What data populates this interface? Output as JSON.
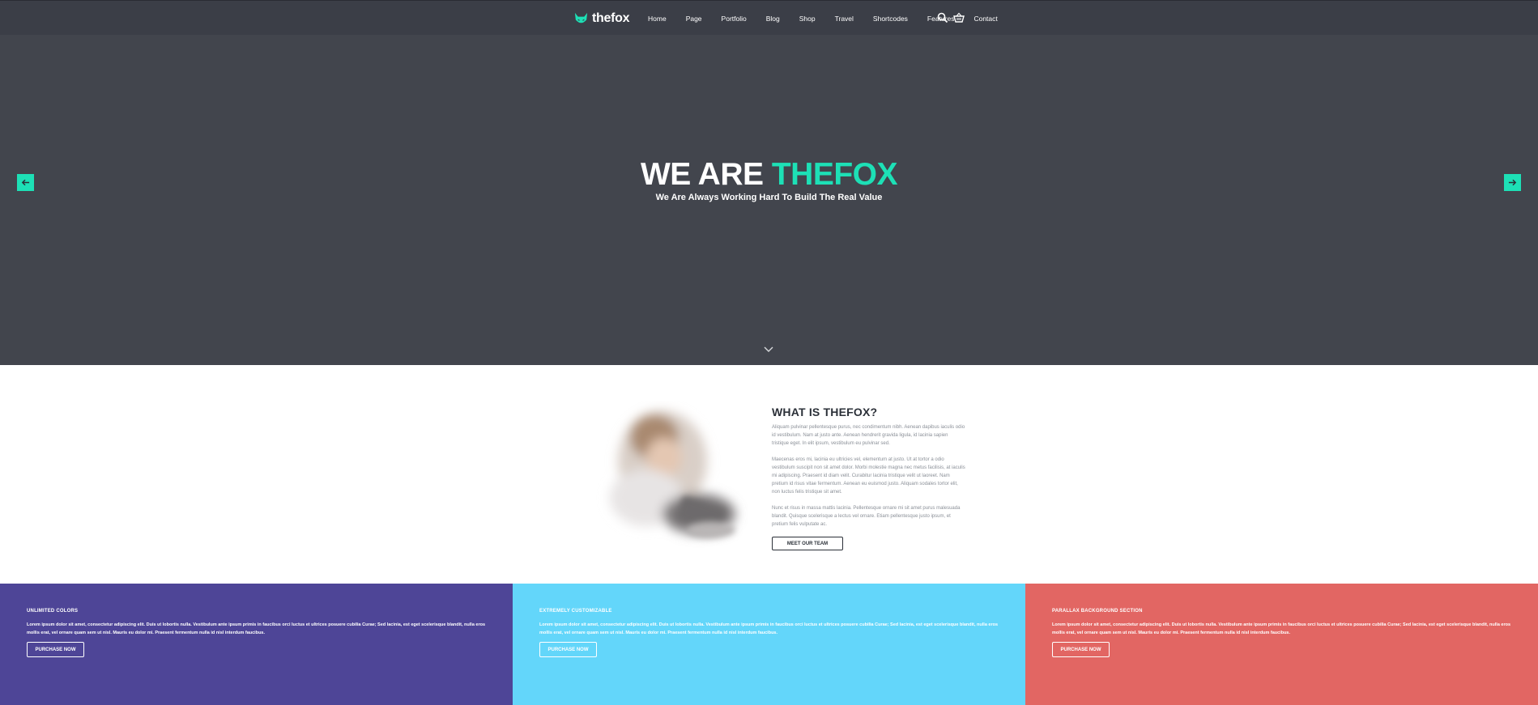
{
  "header": {
    "logo_text": "thefox",
    "menu": [
      {
        "label": "Home"
      },
      {
        "label": "Page"
      },
      {
        "label": "Portfolio"
      },
      {
        "label": "Blog"
      },
      {
        "label": "Shop"
      },
      {
        "label": "Travel"
      },
      {
        "label": "Shortcodes"
      },
      {
        "label": "Features"
      },
      {
        "label": "Contact"
      }
    ],
    "icons": [
      "search-icon",
      "cart-icon"
    ]
  },
  "hero": {
    "title_main": "WE ARE ",
    "title_accent": "THEFOX",
    "subtitle": "We Are Always Working Hard To Build The Real Value",
    "icons": [
      "arrow-left-icon",
      "arrow-right-icon",
      "chevron-down-icon"
    ]
  },
  "about": {
    "title": "WHAT IS THEFOX?",
    "paragraphs": [
      "Aliquam pulvinar pellentesque purus, nec condimentum nibh. Aenean dapibus iaculis odio id vestibulum. Nam at justo ante. Aenean hendrerit gravida ligula, id lacinia sapien tristique eget. In elit ipsum, vestibulum eu pulvinar sed.",
      "Maecenas eros mi, lacinia eu ultricies vel, elementum at justo. Ut at tortor a odio vestibulum suscipit non sit amet dolor. Morbi molestie magna nec metus facilisis, at iaculis mi adipiscing. Praesent id diam velit. Curabitur lacinia tristique velit ut laoreet. Nam pretium id risus vitae fermentum. Aenean eu euismod justo. Aliquam sodales tortor elit, non luctus felis tristique sit amet.",
      "Nunc et risus in massa mattis lacinia. Pellentesque ornare mi sit amet purus malesuada blandit. Quisque scelerisque a lectus vel ornare. Etiam pellentesque justo ipsum, et pretium felis vulputate ac."
    ],
    "button_label": "MEET OUR TEAM"
  },
  "features": [
    {
      "title": "UNLIMITED COLORS",
      "text": "Lorem ipsum dolor sit amet, consectetur adipiscing elit. Duis ut lobortis nulla. Vestibulum ante ipsum primis in faucibus orci luctus et ultrices posuere cubilia Curae; Sed lacinia, est eget scelerisque blandit, nulla eros mollis erat, vel ornare quam sem ut nisl. Mauris eu dolor mi. Praesent fermentum nulla id nisl interdum faucibus.",
      "button_label": "PURCHASE NOW",
      "color": "#4e4597"
    },
    {
      "title": "EXTREMELY CUSTOMIZABLE",
      "text": "Lorem ipsum dolor sit amet, consectetur adipiscing elit. Duis ut lobortis nulla. Vestibulum ante ipsum primis in faucibus orci luctus et ultrices posuere cubilia Curae; Sed lacinia, est eget scelerisque blandit, nulla eros mollis erat, vel ornare quam sem ut nisl. Mauris eu dolor mi. Praesent fermentum nulla id nisl interdum faucibus.",
      "button_label": "PURCHASE NOW",
      "color": "#63d6fa"
    },
    {
      "title": "PARALLAX BACKGROUND SECTION",
      "text": "Lorem ipsum dolor sit amet, consectetur adipiscing elit. Duis ut lobortis nulla. Vestibulum ante ipsum primis in faucibus orci luctus et ultrices posuere cubilia Curae; Sed lacinia, est eget scelerisque blandit, nulla eros mollis erat, vel ornare quam sem ut nisl. Mauris eu dolor mi. Praesent fermentum nulla id nisl interdum faucibus.",
      "button_label": "PURCHASE NOW",
      "color": "#e26663"
    }
  ],
  "colors": {
    "nav_bg": "#3b3e47",
    "hero_bg": "#42454d",
    "accent": "#1de0b6"
  }
}
